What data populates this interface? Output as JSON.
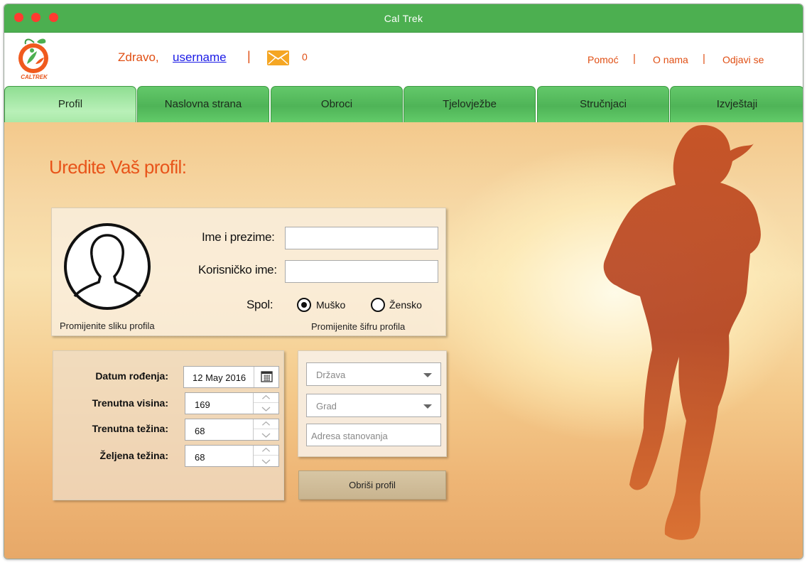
{
  "window": {
    "title": "Cal Trek"
  },
  "header": {
    "logo_text": "CALTREK",
    "greeting": "Zdravo,",
    "username": "username",
    "separator": "|",
    "messages_count": "0",
    "links": {
      "help": "Pomoć",
      "about": "O nama",
      "logout": "Odjavi se"
    }
  },
  "tabs": [
    {
      "label": "Profil",
      "active": true
    },
    {
      "label": "Naslovna strana"
    },
    {
      "label": "Obroci"
    },
    {
      "label": "Tjelovježbe"
    },
    {
      "label": "Stručnjaci"
    },
    {
      "label": "Izvještaji"
    }
  ],
  "page": {
    "title": "Uredite Vaš profil:"
  },
  "profile": {
    "change_photo": "Promijenite sliku profila",
    "full_name_label": "Ime i prezime:",
    "full_name_value": "",
    "username_label": "Korisničko ime:",
    "username_value": "",
    "gender_label": "Spol:",
    "gender_options": [
      "Muško",
      "Žensko"
    ],
    "gender_selected": "Muško",
    "change_password": "Promijenite šifru profila"
  },
  "details": {
    "birthdate_label": "Datum rođenja:",
    "birthdate_value": "12 May 2016",
    "height_label": "Trenutna visina:",
    "height_value": "169",
    "weight_label": "Trenutna težina:",
    "weight_value": "68",
    "target_weight_label": "Željena težina:",
    "target_weight_value": "68"
  },
  "location": {
    "country_placeholder": "Država",
    "city_placeholder": "Grad",
    "address_placeholder": "Adresa stanovanja"
  },
  "actions": {
    "delete_profile": "Obriši profil"
  },
  "colors": {
    "accent": "#e8541a",
    "titlebar": "#4caf50",
    "tab": "#56b95c",
    "tab_active": "#b9f0b8"
  }
}
